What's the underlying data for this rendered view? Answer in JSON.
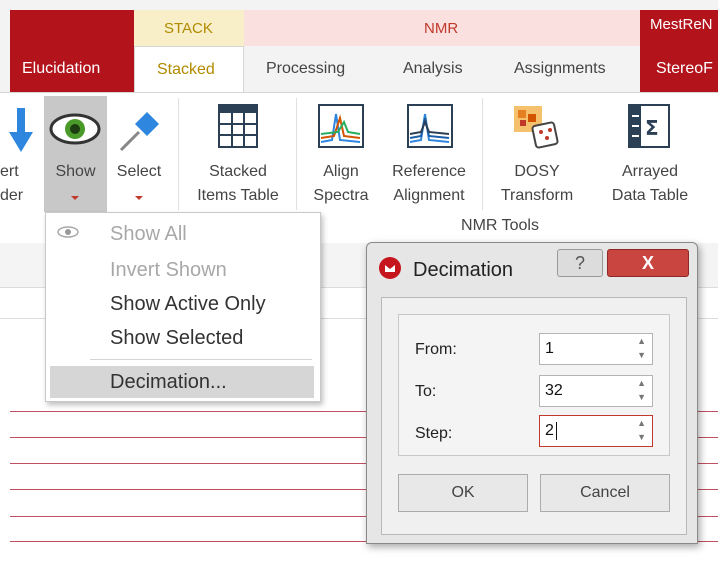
{
  "context_tabs": {
    "stack": "STACK",
    "nmr": "NMR",
    "mest": "MestReN"
  },
  "tabs": [
    "Elucidation",
    "Stacked",
    "Processing",
    "Analysis",
    "Assignments",
    "StereoF"
  ],
  "ribbon": {
    "invert_order_line1": "ert",
    "invert_order_line2": "der",
    "show": "Show",
    "select": "Select",
    "stacked_items_table_line1": "Stacked",
    "stacked_items_table_line2": "Items Table",
    "align_spectra_line1": "Align",
    "align_spectra_line2": "Spectra",
    "reference_alignment_line1": "Reference",
    "reference_alignment_line2": "Alignment",
    "dosy_transform_line1": "DOSY",
    "dosy_transform_line2": "Transform",
    "arrayed_data_table_line1": "Arrayed",
    "arrayed_data_table_line2": "Data Table",
    "group_label": "NMR Tools"
  },
  "show_menu": {
    "items": [
      "Show All",
      "Invert Shown",
      "Show Active Only",
      "Show Selected",
      "Decimation..."
    ],
    "highlighted": "Decimation..."
  },
  "dialog": {
    "title": "Decimation",
    "help": "?",
    "close": "X",
    "from_label": "From:",
    "from_value": "1",
    "to_label": "To:",
    "to_value": "32",
    "step_label": "Step:",
    "step_value": "2",
    "ok": "OK",
    "cancel": "Cancel"
  },
  "colors": {
    "brand_red": "#b3141c",
    "stack_bg": "#f8efc9",
    "nmr_bg": "#fbe0e0",
    "nmr_text": "#c0392b"
  }
}
